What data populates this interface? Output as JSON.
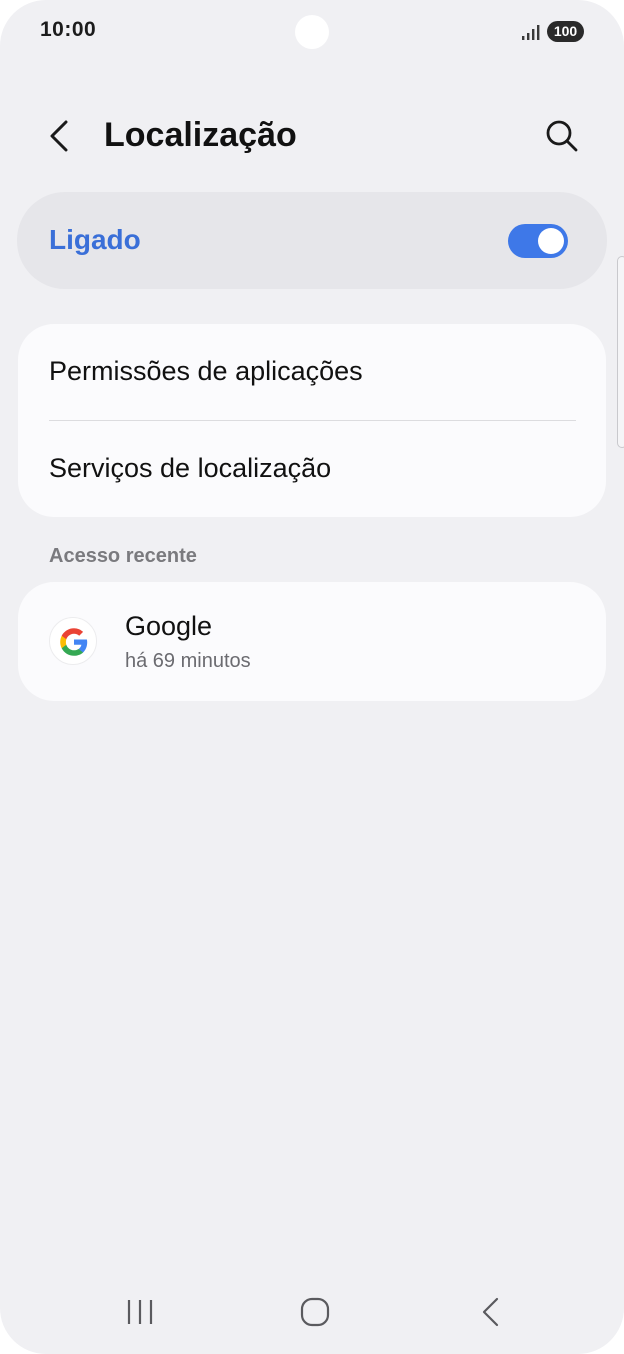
{
  "status_bar": {
    "time": "10:00",
    "battery": "100",
    "icons": [
      "signal-icon",
      "battery-icon"
    ]
  },
  "header": {
    "title": "Localização",
    "back_icon": "chevron-left-icon",
    "search_icon": "search-icon"
  },
  "location_toggle": {
    "label": "Ligado",
    "state": "on",
    "accent_color": "#3e78e8"
  },
  "menu": {
    "items": [
      {
        "label": "Permissões de aplicações"
      },
      {
        "label": "Serviços de localização"
      }
    ]
  },
  "recent_access": {
    "section_title": "Acesso recente",
    "apps": [
      {
        "name": "Google",
        "last_access": "há 69 minutos",
        "icon": "google-icon"
      }
    ]
  },
  "nav_bar": {
    "icons": [
      "recent-apps-icon",
      "home-icon",
      "back-icon"
    ]
  }
}
